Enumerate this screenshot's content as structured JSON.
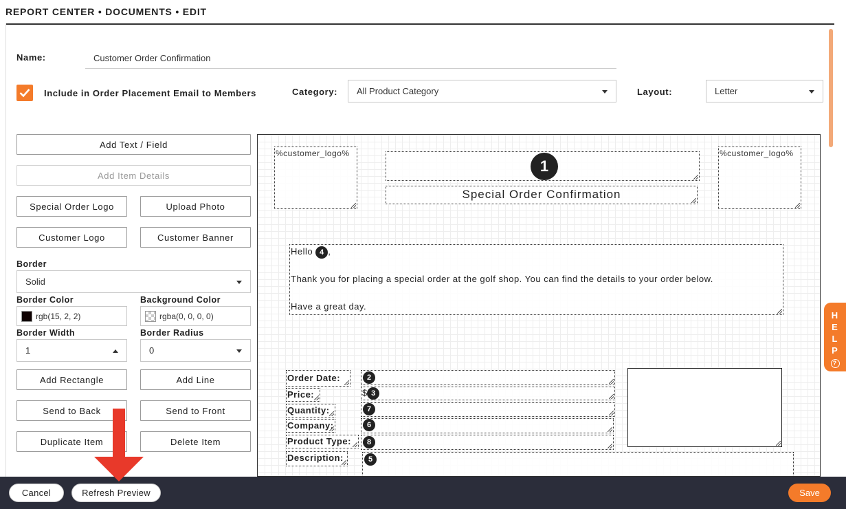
{
  "breadcrumb": "REPORT CENTER • DOCUMENTS • EDIT",
  "form": {
    "name_label": "Name:",
    "name_value": "Customer Order Confirmation",
    "include_label": "Include in Order Placement Email to Members",
    "include_checked": true,
    "category_label": "Category:",
    "category_value": "All Product Category",
    "layout_label": "Layout:",
    "layout_value": "Letter"
  },
  "tools": {
    "add_text": "Add Text / Field",
    "add_item_details": "Add Item Details",
    "special_order_logo": "Special Order Logo",
    "upload_photo": "Upload Photo",
    "customer_logo": "Customer Logo",
    "customer_banner": "Customer Banner",
    "border_label": "Border",
    "border_value": "Solid",
    "border_color_label": "Border Color",
    "border_color_value": "rgb(15, 2, 2)",
    "background_color_label": "Background Color",
    "background_color_value": "rgba(0, 0, 0, 0)",
    "border_width_label": "Border Width",
    "border_width_value": "1",
    "border_radius_label": "Border Radius",
    "border_radius_value": "0",
    "add_rectangle": "Add Rectangle",
    "add_line": "Add Line",
    "send_to_back": "Send to Back",
    "send_to_front": "Send to Front",
    "duplicate_item": "Duplicate Item",
    "delete_item": "Delete Item"
  },
  "canvas": {
    "logo_left": "%customer_logo%",
    "logo_right": "%customer_logo%",
    "header_badge": "1",
    "title": "Special Order Confirmation",
    "greeting": "Hello",
    "greeting_badge": "4",
    "greeting_suffix": ",",
    "line1": "Thank you for placing a special order at the golf shop. You can find the details to your order below.",
    "line2": "Have a great day.",
    "fields": [
      {
        "label": "Order Date:",
        "prefix": "",
        "badge": "2"
      },
      {
        "label": "Price:",
        "prefix": "$",
        "badge": "3"
      },
      {
        "label": "Quantity:",
        "prefix": "",
        "badge": "7"
      },
      {
        "label": "Company:",
        "prefix": "",
        "badge": "6"
      },
      {
        "label": "Product Type:",
        "prefix": "",
        "badge": "8"
      },
      {
        "label": "Description:",
        "prefix": "",
        "badge": "5"
      }
    ]
  },
  "help": {
    "letters": [
      "H",
      "E",
      "L",
      "P"
    ],
    "icon": "?"
  },
  "footer": {
    "cancel": "Cancel",
    "refresh_preview": "Refresh Preview",
    "save": "Save"
  },
  "colors": {
    "accent": "#f47b2a",
    "footer_bg": "#2b2d3a",
    "arrow": "#e8392a"
  }
}
